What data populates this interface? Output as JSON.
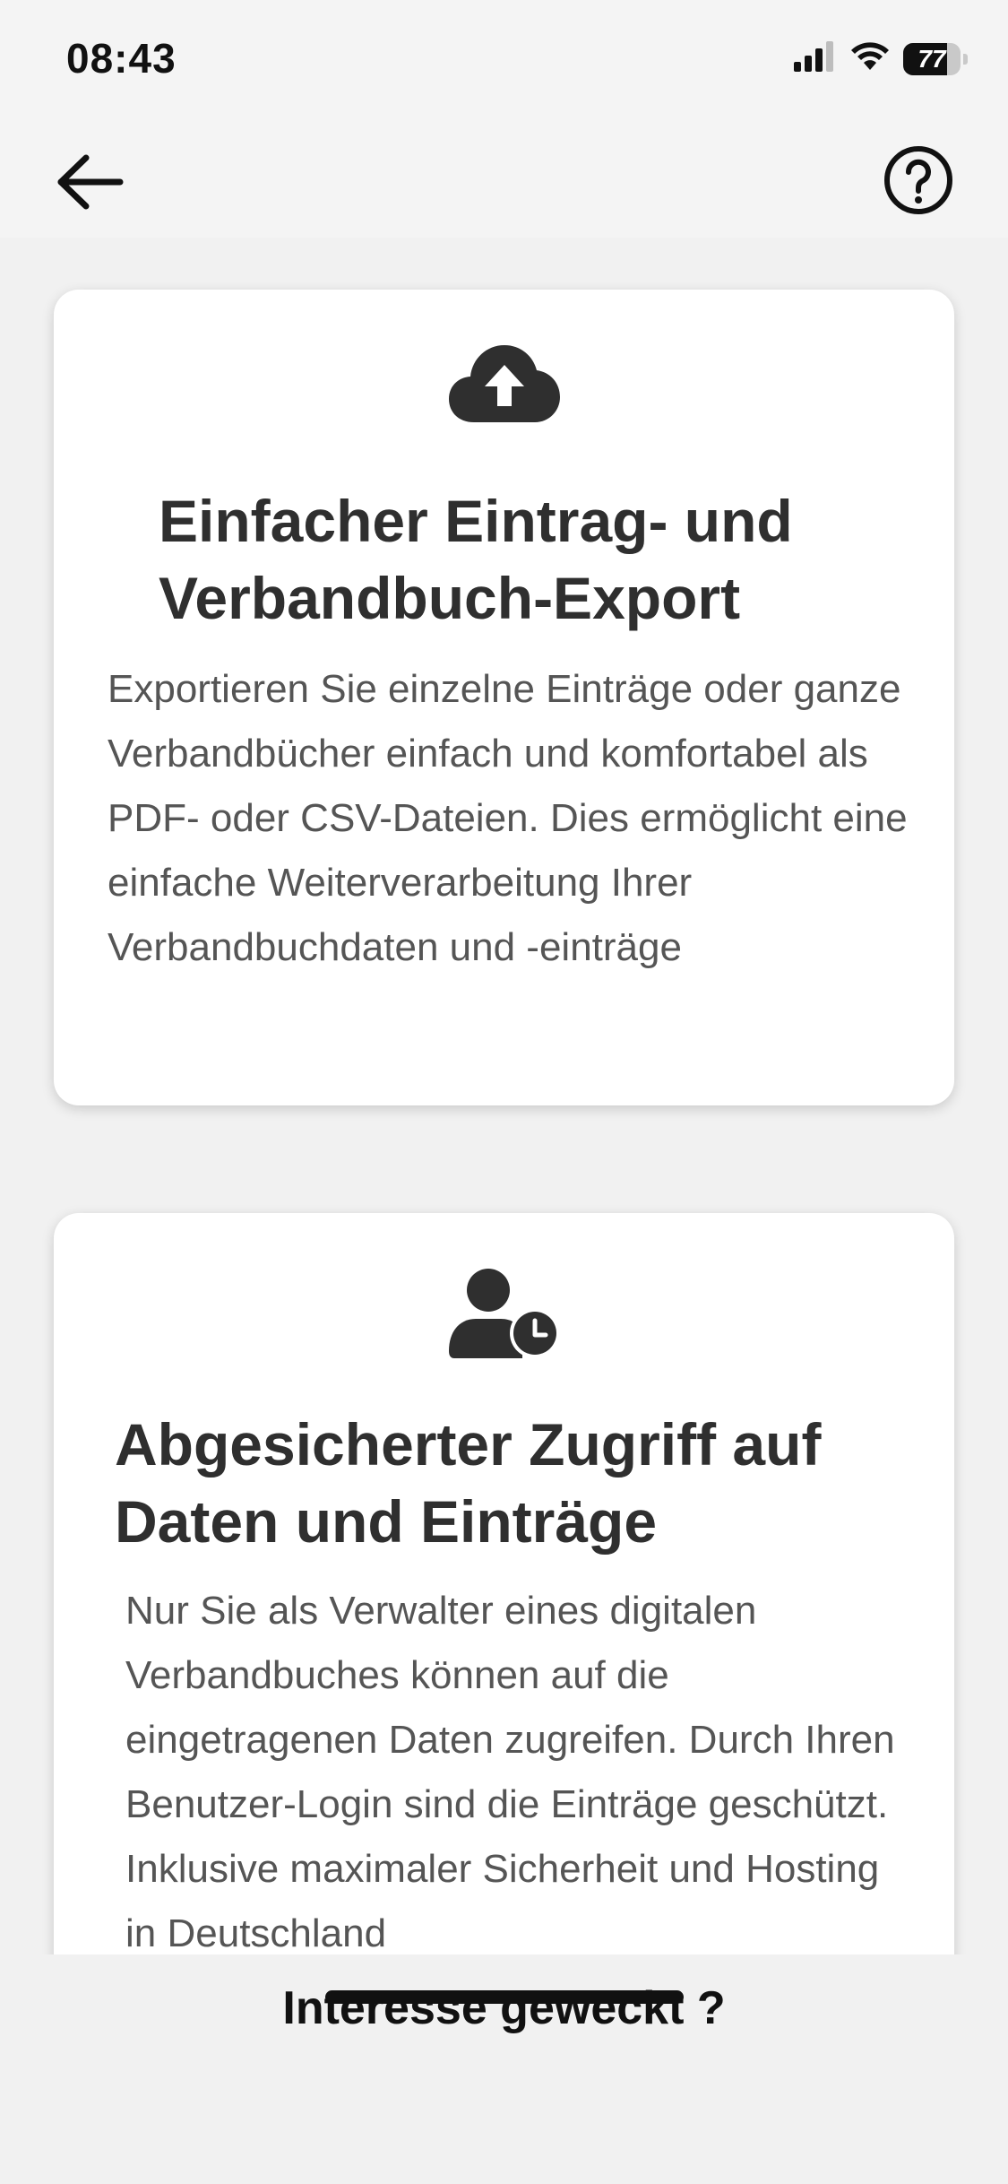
{
  "status_bar": {
    "time": "08:43",
    "battery_level": "77",
    "icons": [
      "signal-icon",
      "wifi-icon",
      "battery-icon"
    ]
  },
  "nav": {
    "back_icon": "arrow-left-icon",
    "help_icon": "question-circle-icon"
  },
  "cards": [
    {
      "icon": "cloud-upload-icon",
      "title": "Einfacher Eintrag- und Verbandbuch-Export",
      "description": "Exportieren Sie einzelne Einträge oder ganze Verbandbücher einfach und komfortabel als PDF- oder CSV-Dateien. Dies ermöglicht eine einfache Weiterverarbeitung Ihrer Verbandbuchdaten und -einträge"
    },
    {
      "icon": "user-clock-icon",
      "title": "Abgesicherter Zugriff auf Daten und Einträge",
      "description": "Nur Sie als Verwalter eines digitalen Verbandbuches können auf die eingetragenen Daten zugreifen. Durch Ihren Benutzer-Login sind die Einträge geschützt. Inklusive maximaler Sicherheit und Hosting in Deutschland"
    }
  ],
  "footer": {
    "cta_text": "Interesse geweckt ?"
  },
  "colors": {
    "background": "#f1f1f1",
    "card": "#ffffff",
    "title_text": "#2f2f2f",
    "body_text": "#555555"
  }
}
